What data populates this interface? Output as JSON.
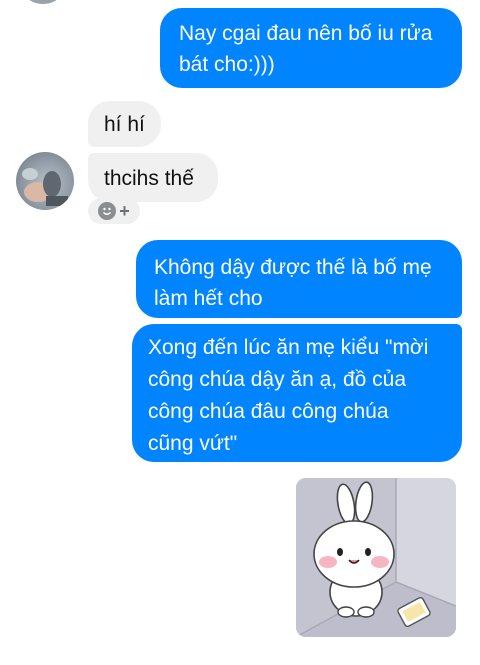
{
  "messages": [
    {
      "id": "m1",
      "direction": "outgoing",
      "lines": [
        "Nay cgai đau nên bố iu rửa",
        "bát cho:)))"
      ]
    },
    {
      "id": "m2",
      "direction": "incoming",
      "lines": [
        "hí hí"
      ]
    },
    {
      "id": "m3",
      "direction": "incoming",
      "lines": [
        "thcihs thế"
      ]
    },
    {
      "id": "m4",
      "direction": "outgoing",
      "lines": [
        "Không dậy được thế là bố mẹ",
        "làm hết cho"
      ]
    },
    {
      "id": "m5",
      "direction": "outgoing",
      "lines": [
        "Xong đến lúc ăn mẹ kiểu \"mời",
        "công chúa dậy ăn ạ, đồ của",
        "công chúa đâu công chúa",
        "cũng vứt\""
      ]
    }
  ],
  "reaction": {
    "icon": "smiley-icon",
    "add_symbol": "+"
  },
  "sticker": {
    "icon": "bunny-sticker"
  },
  "colors": {
    "outgoing_bubble": "#0084ff",
    "incoming_bubble": "#f1f0f0"
  }
}
